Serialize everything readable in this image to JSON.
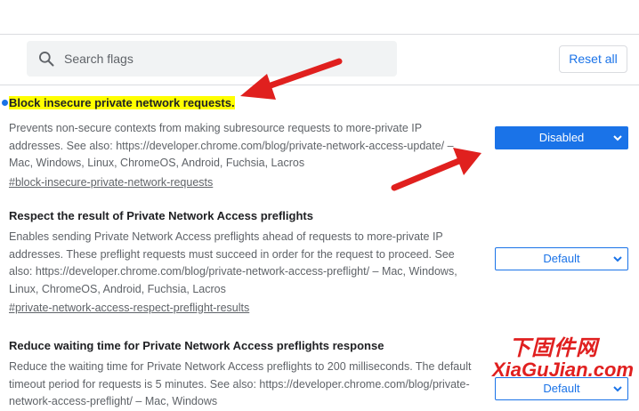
{
  "search": {
    "placeholder": "Search flags"
  },
  "header": {
    "reset_label": "Reset all"
  },
  "flags": [
    {
      "title": "Block insecure private network requests.",
      "description": "Prevents non-secure contexts from making subresource requests to more-private IP addresses. See also: https://developer.chrome.com/blog/private-network-access-update/ – Mac, Windows, Linux, ChromeOS, Android, Fuchsia, Lacros",
      "anchor": "#block-insecure-private-network-requests",
      "value": "Disabled"
    },
    {
      "title": "Respect the result of Private Network Access preflights",
      "description": "Enables sending Private Network Access preflights ahead of requests to more-private IP addresses. These preflight requests must succeed in order for the request to proceed. See also: https://developer.chrome.com/blog/private-network-access-preflight/ – Mac, Windows, Linux, ChromeOS, Android, Fuchsia, Lacros",
      "anchor": "#private-network-access-respect-preflight-results",
      "value": "Default"
    },
    {
      "title": "Reduce waiting time for Private Network Access preflights response",
      "description": "Reduce the waiting time for Private Network Access preflights to 200 milliseconds. The default timeout period for requests is 5 minutes. See also: https://developer.chrome.com/blog/private-network-access-preflight/ – Mac, Windows",
      "value": "Default"
    }
  ],
  "watermark": {
    "line1": "下固件网",
    "line2": "XiaGuJian.com"
  },
  "colors": {
    "accent": "#1a73e8",
    "highlight": "#ffff00",
    "arrow": "#e0201e"
  }
}
